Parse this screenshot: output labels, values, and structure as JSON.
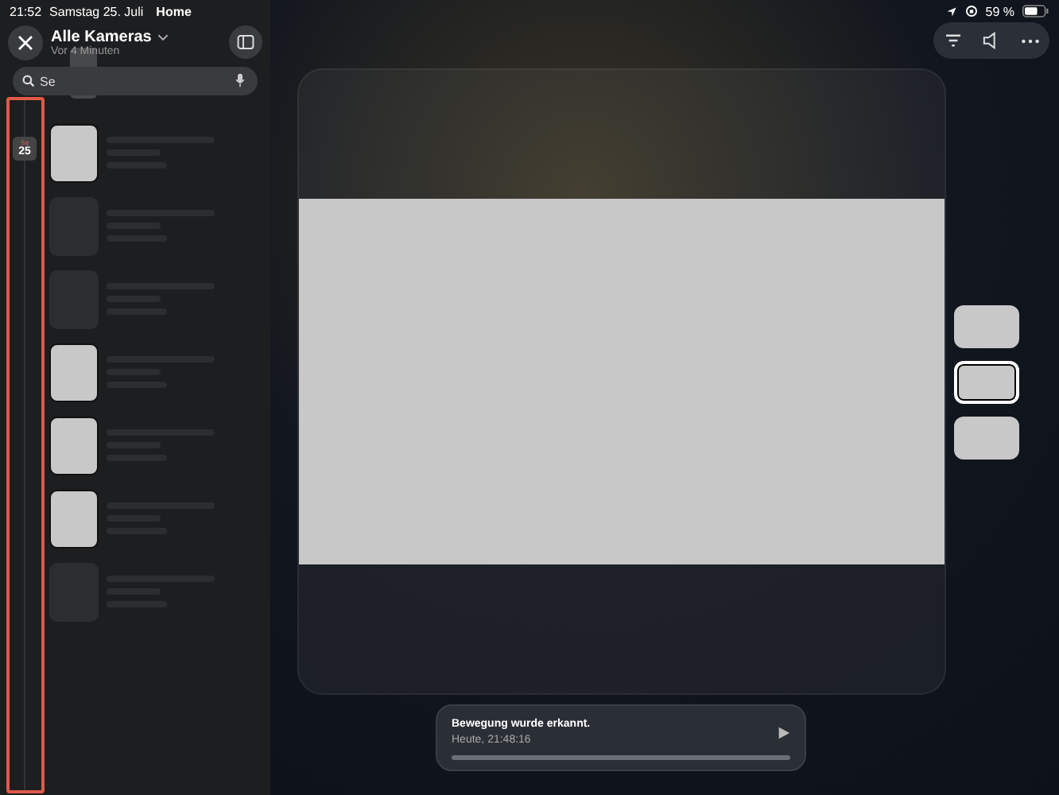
{
  "status_bar": {
    "time": "21:52",
    "date": "Samstag 25. Juli",
    "app": "Home",
    "battery": "59 %"
  },
  "header": {
    "title": "Alle Kameras",
    "subtitle": "Vor 4 Minuten"
  },
  "search": {
    "placeholder": "Se"
  },
  "timeline": {
    "weekday": "Sa",
    "day": "25"
  },
  "events": [
    {
      "loaded": true
    },
    {
      "loaded": false
    },
    {
      "loaded": false
    },
    {
      "loaded": true
    },
    {
      "loaded": true
    },
    {
      "loaded": true
    },
    {
      "loaded": false
    }
  ],
  "camera_thumbnails": [
    {
      "selected": false
    },
    {
      "selected": true
    },
    {
      "selected": false
    }
  ],
  "notification": {
    "title": "Bewegung wurde erkannt.",
    "time": "Heute, 21:48:16"
  }
}
